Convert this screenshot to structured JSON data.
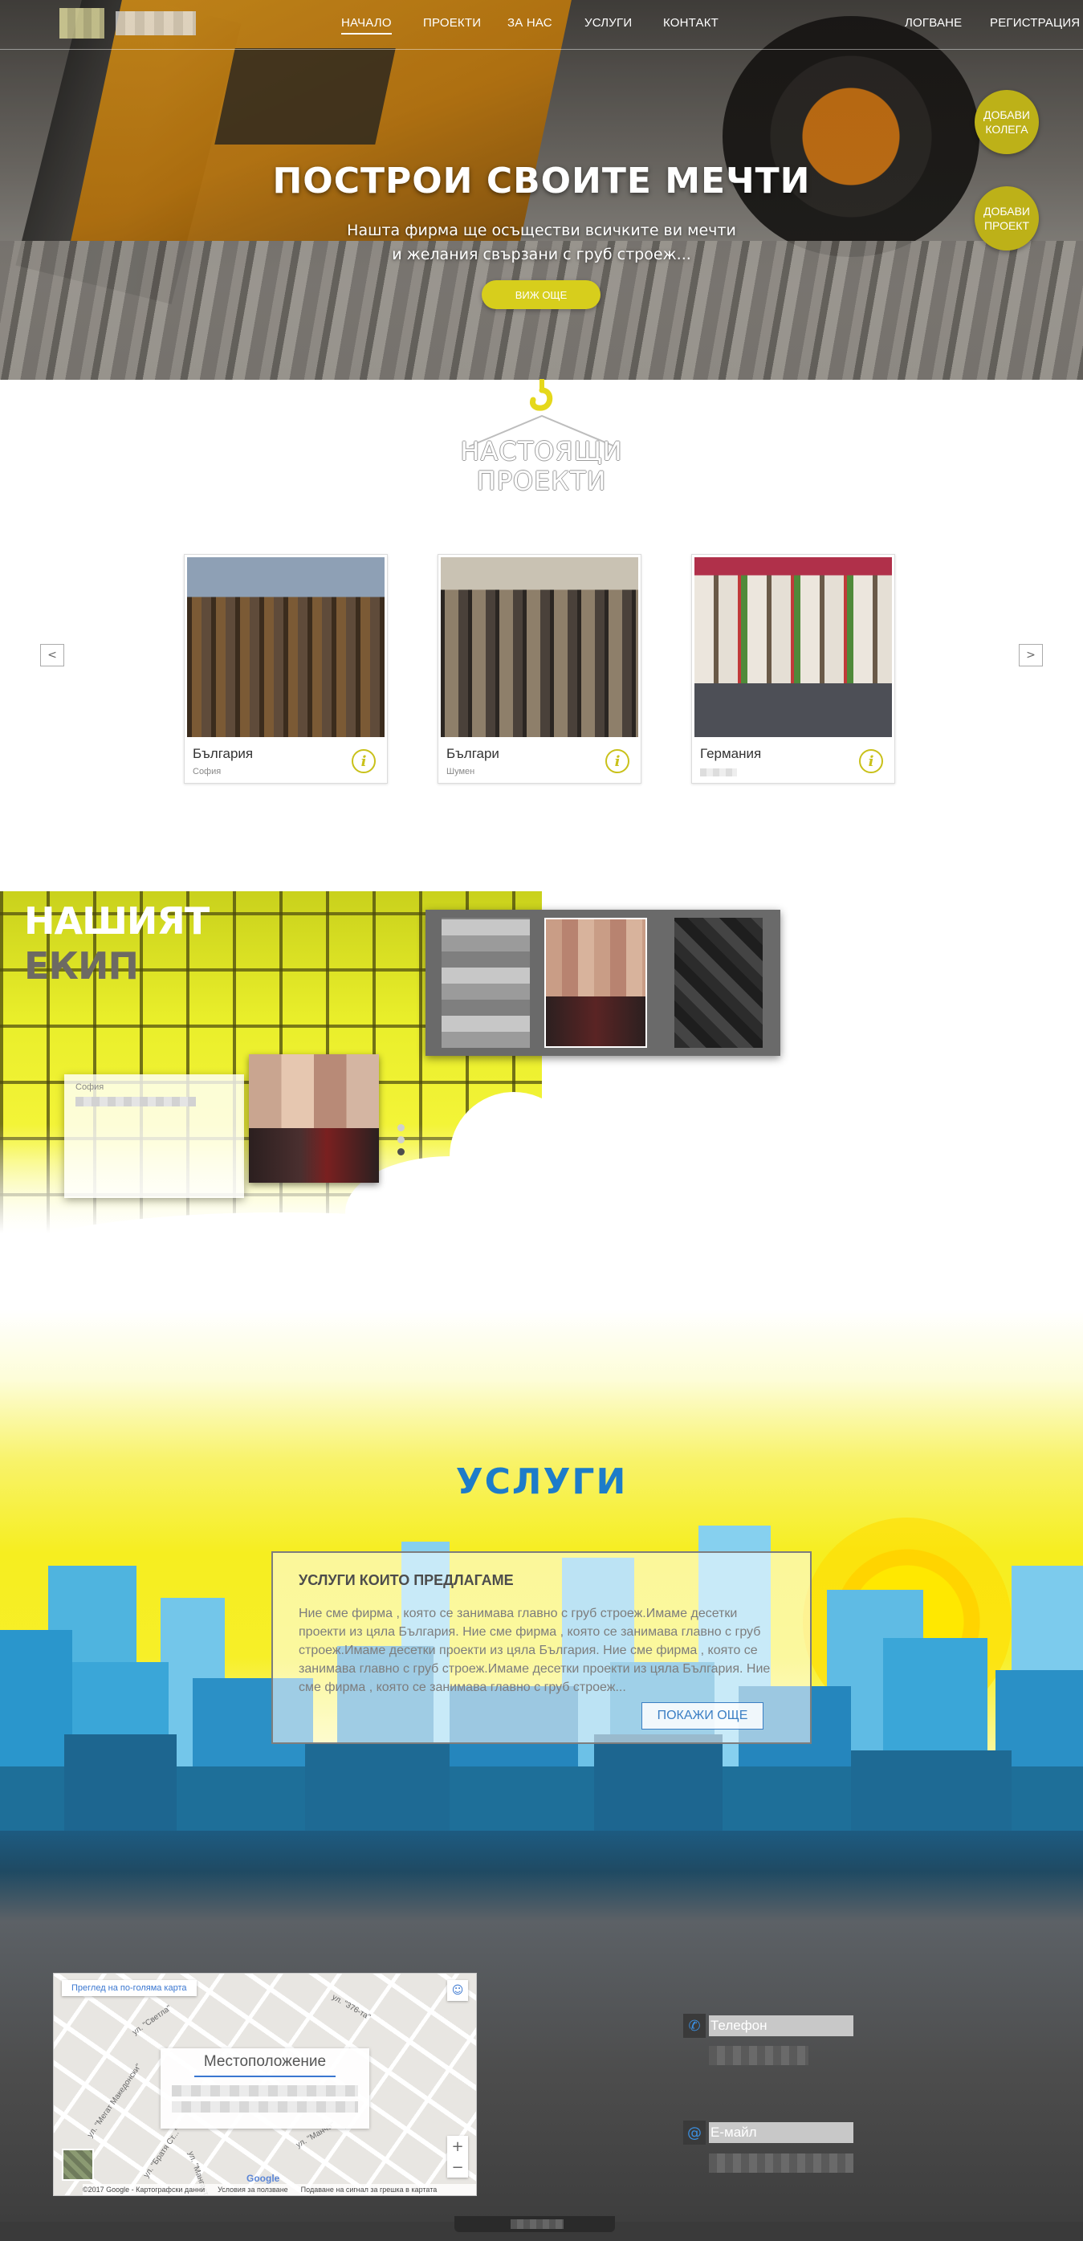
{
  "nav": {
    "items": [
      "НАЧАЛО",
      "ПРОЕКТИ",
      "ЗА НАС",
      "УСЛУГИ",
      "КОНТАКТ"
    ],
    "active_index": 0,
    "login": "ЛОГВАНЕ",
    "register": "РЕГИСТРАЦИЯ"
  },
  "hero": {
    "title": "ПОСТРОИ СВОИТЕ МЕЧТИ",
    "subtitle_line1": "Нашта фирма ще осъществи всичките ви мечти",
    "subtitle_line2": "и желания свързани с груб строеж...",
    "more_button": "ВИЖ ОЩЕ",
    "add_colleague": [
      "ДОБАВИ",
      "КОЛЕГА"
    ],
    "add_project": [
      "ДОБАВИ",
      "ПРОЕКТ"
    ],
    "accent_color": "#d7ce1c"
  },
  "projects": {
    "title_line1": "НАСТОЯЩИ",
    "title_line2": "ПРОЕКТИ",
    "prev": "<",
    "next": ">",
    "cards": [
      {
        "title": "България",
        "city": "София"
      },
      {
        "title": "Българи",
        "city": "Шумен"
      },
      {
        "title": "Германия",
        "city": ""
      }
    ]
  },
  "team": {
    "title_line1": "НАШИЯТ",
    "title_line2": "ЕКИП",
    "member_city": "София"
  },
  "services": {
    "title": "УСЛУГИ",
    "box_heading": "УСЛУГИ КОИТО ПРЕДЛАГАМЕ",
    "box_text": "Ние сме фирма , която се занимава главно с груб строеж.Имаме десетки проекти из цяла България. Ние сме фирма , която се занимава главно с груб строеж.Имаме десетки проекти из цяла България. Ние сме фирма , която се занимава главно с груб строеж.Имаме десетки проекти из цяла България. Ние сме фирма , която се занимава главно с груб строеж...",
    "more_button": "ПОКАЖИ ОЩЕ",
    "title_color": "#1d7cc9"
  },
  "contact": {
    "map_larger": "Преглед на по-голяма карта",
    "location_title": "Местоположение",
    "phone_label": "Телефон",
    "email_label": "Е-майл",
    "map_attribution": [
      "©2017 Google - Картографски данни",
      "Условия за ползване",
      "Подаване на сигнал за грешка в картата"
    ],
    "google": "Google",
    "streets": [
      "ул. \"Светла\"",
      "ул. \"376-та\"",
      "ул. \"Мегат Македонски\"",
      "ул. \"Братя Ст...\"",
      "ул. \"Манчо\"",
      "ул. \"Мангастица\""
    ]
  }
}
